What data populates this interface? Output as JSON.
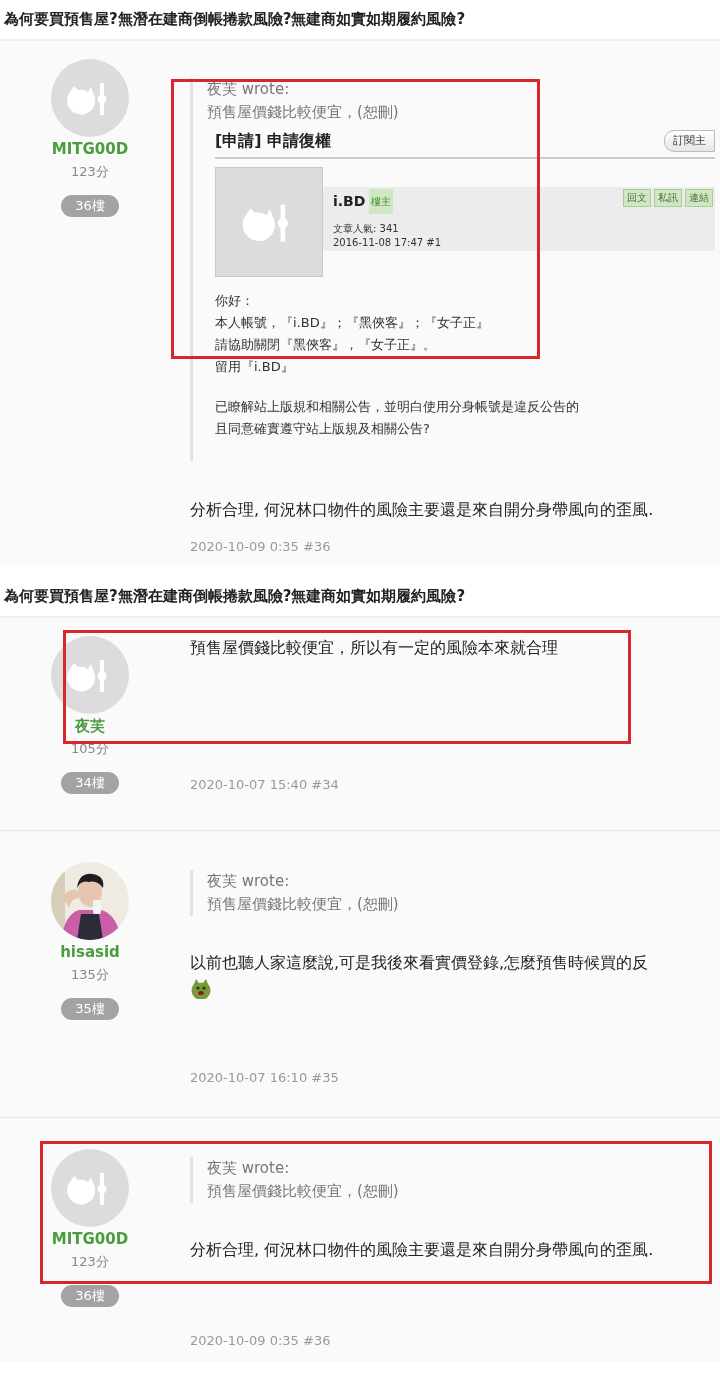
{
  "panels": [
    {
      "title": "為何要買預售屋?無潛在建商倒帳捲款風險?無建商如實如期履約風險?",
      "posts": [
        {
          "author": {
            "name": "MITG00D",
            "score": "123分",
            "has_photo": false
          },
          "floor": "36樓",
          "highlighted": false,
          "quote": {
            "highlighted": true,
            "author_line": "夜芙 wrote:",
            "text": "預售屋價錢比較便宜，(恕刪)",
            "embedded": {
              "title": "[申請] 申請復權",
              "subscribe_button": "訂閱主",
              "post": {
                "author": "i.BD",
                "badge": "樓主",
                "views": "文章人氣: 341",
                "date": "2016-11-08 17:47  #1",
                "actions": [
                  "回文",
                  "私訊",
                  "連結"
                ],
                "paragraphs": [
                  [
                    "你好：",
                    "本人帳號，『i.BD』；『黑俠客』；『女子正』",
                    "請協助關閉『黑俠客』，『女子正』。",
                    "留用『i.BD』"
                  ],
                  [
                    "已瞭解站上版規和相關公告，並明白使用分身帳號是違反公告的",
                    "且同意確實遵守站上版規及相關公告?"
                  ]
                ]
              }
            }
          },
          "body": [
            {
              "kind": "text",
              "text": "分析合理, 何況林口物件的風險主要還是來自開分身帶風向的歪風."
            }
          ],
          "date": "2020-10-09 0:35 #36"
        }
      ]
    },
    {
      "title": "為何要買預售屋?無潛在建商倒帳捲款風險?無建商如實如期履約風險?",
      "posts": [
        {
          "author": {
            "name": "夜芙",
            "score": "105分",
            "has_photo": false
          },
          "floor": "34樓",
          "highlighted": true,
          "body": [
            {
              "kind": "text",
              "text": "預售屋價錢比較便宜，所以有一定的風險本來就合理"
            }
          ],
          "date": "2020-10-07 15:40 #34"
        },
        {
          "author": {
            "name": "hisasid",
            "score": "135分",
            "has_photo": true
          },
          "floor": "35樓",
          "highlighted": false,
          "quote": {
            "highlighted": false,
            "author_line": "夜芙 wrote:",
            "text": "預售屋價錢比較便宜，(恕刪)"
          },
          "body": [
            {
              "kind": "text",
              "text": "以前也聽人家這麼說,可是我後來看實價登錄,怎麼預售時候買的反"
            },
            {
              "kind": "emoji"
            }
          ],
          "date": "2020-10-07 16:10 #35"
        },
        {
          "author": {
            "name": "MITG00D",
            "score": "123分",
            "has_photo": false
          },
          "floor": "36樓",
          "highlighted": true,
          "quote": {
            "highlighted": false,
            "author_line": "夜芙 wrote:",
            "text": "預售屋價錢比較便宜，(恕刪)"
          },
          "body": [
            {
              "kind": "text",
              "text": "分析合理, 何況林口物件的風險主要還是來自開分身帶風向的歪風."
            }
          ],
          "date": "2020-10-09 0:35 #36"
        }
      ]
    }
  ]
}
